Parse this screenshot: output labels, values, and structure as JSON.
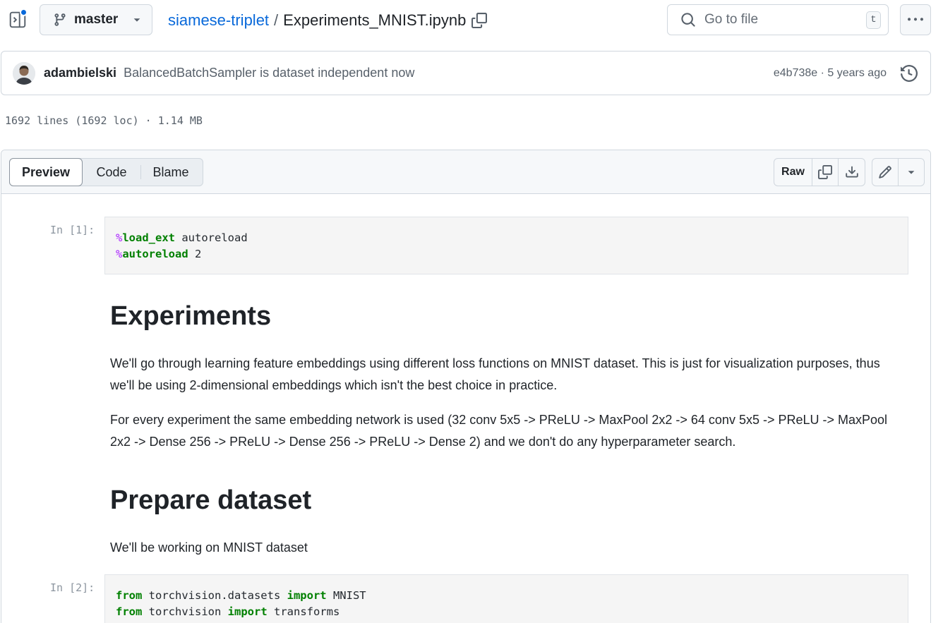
{
  "top": {
    "branch": "master",
    "repo": "siamese-triplet",
    "path_separator": "/",
    "file": "Experiments_MNIST.ipynb",
    "search_placeholder": "Go to file",
    "search_shortcut": "t"
  },
  "commit": {
    "author": "adambielski",
    "message": "BalancedBatchSampler is dataset independent now",
    "meta": "e4b738e · 5 years ago"
  },
  "file_info": "1692 lines (1692 loc) · 1.14 MB",
  "file_header": {
    "tabs": [
      "Preview",
      "Code",
      "Blame"
    ],
    "raw": "Raw"
  },
  "notebook": {
    "cell1": {
      "prompt": "In [1]:",
      "lines": [
        [
          [
            "mg",
            "%"
          ],
          [
            "kw",
            "load_ext"
          ],
          [
            "",
            " autoreload"
          ]
        ],
        [
          [
            "mg",
            "%"
          ],
          [
            "kw",
            "autoreload"
          ],
          [
            "",
            " 2"
          ]
        ]
      ]
    },
    "h1": "Experiments",
    "p1": "We'll go through learning feature embeddings using different loss functions on MNIST dataset. This is just for visualization purposes, thus we'll be using 2-dimensional embeddings which isn't the best choice in practice.",
    "p2": "For every experiment the same embedding network is used (32 conv 5x5 -> PReLU -> MaxPool 2x2 -> 64 conv 5x5 -> PReLU -> MaxPool 2x2 -> Dense 256 -> PReLU -> Dense 256 -> PReLU -> Dense 2) and we don't do any hyperparameter search.",
    "h2": "Prepare dataset",
    "p3": "We'll be working on MNIST dataset",
    "cell2": {
      "prompt": "In [2]:",
      "lines": [
        [
          [
            "kw",
            "from"
          ],
          [
            "",
            " torchvision.datasets "
          ],
          [
            "kw",
            "import"
          ],
          [
            "",
            " MNIST"
          ]
        ],
        [
          [
            "kw",
            "from"
          ],
          [
            "",
            " torchvision "
          ],
          [
            "kw",
            "import"
          ],
          [
            "",
            " transforms"
          ]
        ]
      ]
    }
  },
  "colors": {
    "link": "#0969da",
    "border": "#d0d7de",
    "header_bg": "#f6f8fa",
    "code_bg": "#f5f5f5",
    "keyword": "#008000",
    "magic": "#aa22ff",
    "notification_dot": "#0969da"
  }
}
